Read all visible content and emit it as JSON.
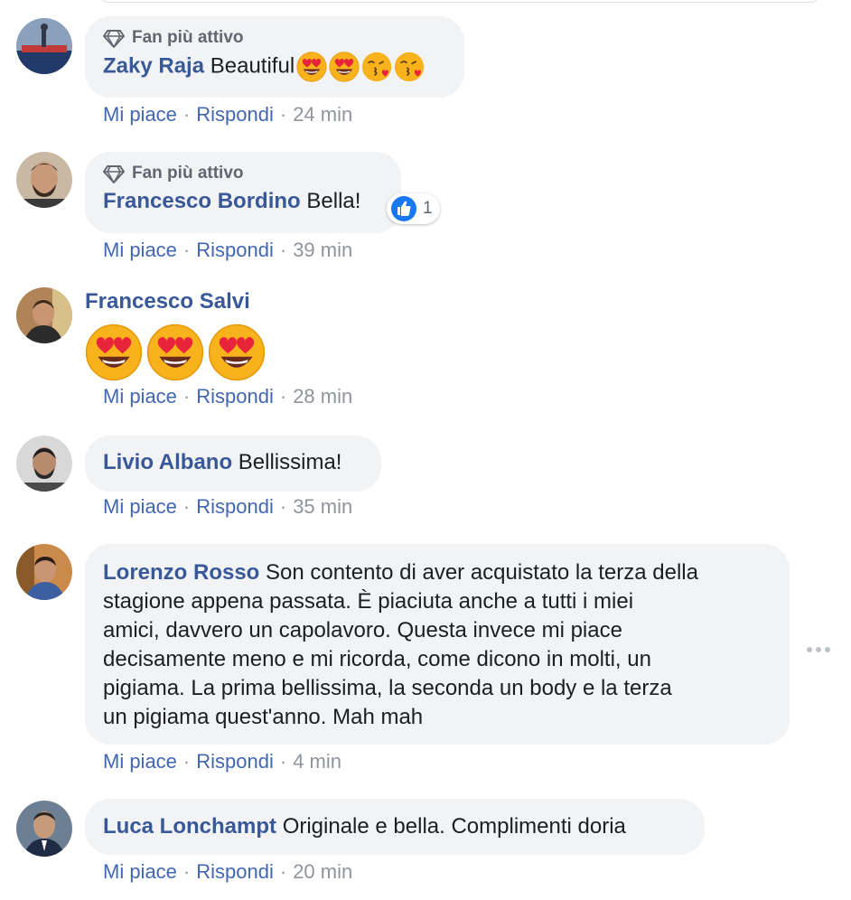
{
  "comments": [
    {
      "badge": "Fan più attivo",
      "author": "Zaky Raja",
      "text": "Beautiful",
      "emojis": [
        "heart-eyes",
        "heart-eyes",
        "kissing-heart",
        "kissing-heart"
      ],
      "like_label": "Mi piace",
      "reply_label": "Rispondi",
      "time": "24 min"
    },
    {
      "badge": "Fan più attivo",
      "author": "Francesco Bordino",
      "text": "Bella!",
      "reaction_count": "1",
      "like_label": "Mi piace",
      "reply_label": "Rispondi",
      "time": "39 min"
    },
    {
      "author": "Francesco Salvi",
      "emojis": [
        "heart-eyes",
        "heart-eyes",
        "heart-eyes"
      ],
      "like_label": "Mi piace",
      "reply_label": "Rispondi",
      "time": "28 min"
    },
    {
      "author": "Livio Albano",
      "text": "Bellissima!",
      "like_label": "Mi piace",
      "reply_label": "Rispondi",
      "time": "35 min"
    },
    {
      "author": "Lorenzo Rosso",
      "text_lines": [
        "Son contento di aver acquistato la terza della",
        "stagione appena passata. È piaciuta anche a tutti i miei",
        "amici, davvero un capolavoro. Questa invece mi piace",
        "decisamente meno e mi ricorda, come dicono in molti, un",
        "pigiama. La prima bellissima, la seconda un body e la terza",
        "un pigiama quest'anno. Mah mah"
      ],
      "like_label": "Mi piace",
      "reply_label": "Rispondi",
      "time": "4 min"
    },
    {
      "author": "Luca Lonchampt",
      "text": "Originale e bella. Complimenti doria",
      "like_label": "Mi piace",
      "reply_label": "Rispondi",
      "time": "20 min"
    }
  ],
  "colors": {
    "link": "#385898",
    "action_link": "#4267b2",
    "bubble_bg": "#f2f3f5",
    "meta": "#90949c",
    "like_blue": "#1877f2"
  },
  "icons": [
    "diamond-icon",
    "heart-eyes-emoji",
    "kissing-heart-emoji",
    "like-reaction-icon",
    "more-options-icon"
  ]
}
